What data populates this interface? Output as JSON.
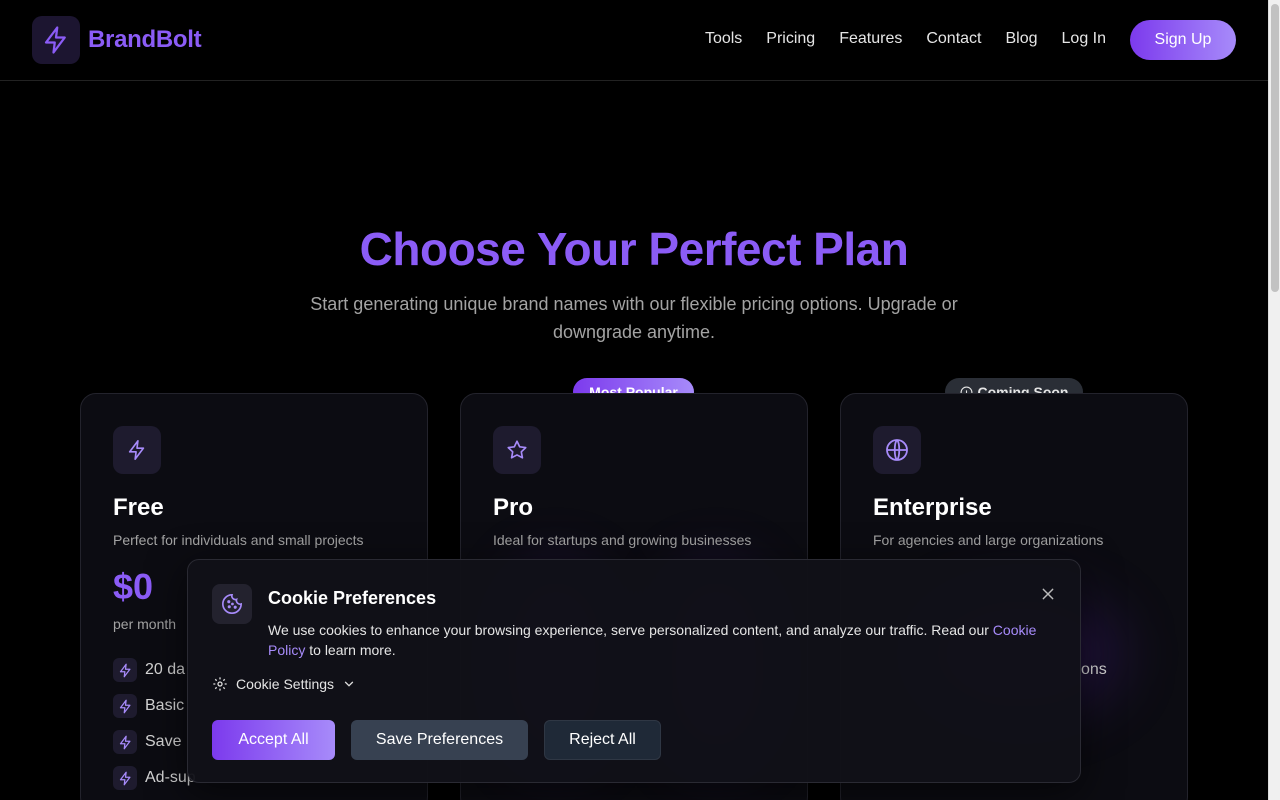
{
  "header": {
    "logo_icon": "bolt-icon",
    "brand": "BrandBolt",
    "nav": [
      "Tools",
      "Pricing",
      "Features",
      "Contact",
      "Blog",
      "Log In"
    ],
    "signup_label": "Sign Up"
  },
  "hero": {
    "title": "Choose Your Perfect Plan",
    "subtitle": "Start generating unique brand names with our flexible pricing options. Upgrade or downgrade anytime."
  },
  "plans": [
    {
      "icon": "bolt-icon",
      "name": "Free",
      "description": "Perfect for individuals and small projects",
      "price": "$0",
      "period": "per month",
      "features": [
        "20 da",
        "Basic",
        "Save",
        "Ad-sup"
      ]
    },
    {
      "icon": "star-icon",
      "name": "Pro",
      "description": "Ideal for startups and growing businesses",
      "badge": "Most Popular"
    },
    {
      "icon": "globe-icon",
      "name": "Enterprise",
      "description": "For agencies and large organizations",
      "badge": "Coming Soon",
      "badge_icon": "info-circle-icon",
      "partial_feature": "ons"
    }
  ],
  "cookie": {
    "icon": "cookie-icon",
    "title": "Cookie Preferences",
    "text_before": "We use cookies to enhance your browsing experience, serve personalized content, and analyze our traffic. Read our ",
    "link": "Cookie Policy",
    "text_after": " to learn more.",
    "settings_label": "Cookie Settings",
    "accept_label": "Accept All",
    "save_label": "Save Preferences",
    "reject_label": "Reject All"
  },
  "colors": {
    "accent": "#8b5cf6",
    "accent_light": "#a78bfa",
    "background": "#000000",
    "card": "#0c0c12"
  }
}
